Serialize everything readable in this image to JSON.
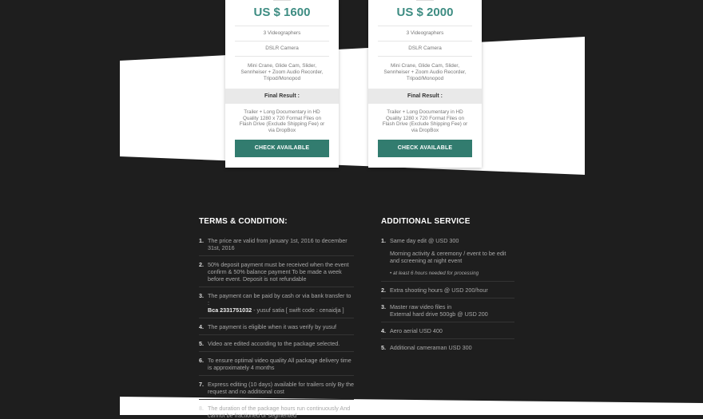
{
  "colors": {
    "accent": "#3d8c82",
    "button": "#327c6f",
    "background": "#1e1e1e"
  },
  "cards": [
    {
      "price": "US $ 1600",
      "features": [
        "3 Videographers",
        "DSLR Camera",
        "Mini Crane, Glide Cam, Slider, Sennheiser + Zoom Audio Recorder, Tripod/Monopod"
      ],
      "final_label": "Final Result :",
      "final_text": "Trailer + Long Documentary in HD Quality 1280 x 720 Format Files on Flash Drive (Exclude Shipping Fee) or via DropBox",
      "button": "CHECK AVAILABLE"
    },
    {
      "price": "US $ 2000",
      "features": [
        "3 Videographers",
        "DSLR Camera",
        "Mini Crane, Glide Cam, Slider, Sennheiser + Zoom Audio Recorder, Tripod/Monopod"
      ],
      "final_label": "Final Result :",
      "final_text": "Trailer + Long Documentary in HD Quality 1280 x 720 Format Files on Flash Drive (Exclude Shipping Fee) or via DropBox",
      "button": "CHECK AVAILABLE"
    }
  ],
  "terms": {
    "title": "TERMS & CONDITION:",
    "items": [
      {
        "num": "1.",
        "text": "The price are valid from january 1st, 2016 to december 31st, 2016"
      },
      {
        "num": "2.",
        "text": "50% deposit payment must be received when the event confirm & 50% balance payment To be made a week before event. Deposit is not refundable"
      },
      {
        "num": "3.",
        "text": "The payment can be paid by cash or via bank transfer to :",
        "bank": "Bca 2331751032",
        "bank_tail": " - yusuf satia [ swift code : cenaidja ]"
      },
      {
        "num": "4.",
        "text": "The payment is eligible when it was verify by yusuf"
      },
      {
        "num": "5.",
        "text": "Video are edited according to the package selected."
      },
      {
        "num": "6.",
        "text": "To ensure optimal video quality All package delivery time is approximately 4 months"
      },
      {
        "num": "7.",
        "text": "Express editing (10 days) available for trailers only By the request and no additional cost"
      },
      {
        "num": "8.",
        "text": "The duration of the package hours run continuously And cannot be fractioned or segmented"
      }
    ]
  },
  "additional": {
    "title": "ADDITIONAL SERVICE",
    "items": [
      {
        "num": "1.",
        "text": "Same day edit @ USD 300",
        "sub": "Morning activity & ceremony / event to be edit and screening at night event",
        "note": "• at least 6 hours needed for processing"
      },
      {
        "num": "2.",
        "text": "Extra shooting hours @ USD 200/hour"
      },
      {
        "num": "3.",
        "text": "Master raw video files in",
        "text2": "External hard drive 500gb @ USD 200"
      },
      {
        "num": "4.",
        "text": "Aero aerial USD 400"
      },
      {
        "num": "5.",
        "text": "Additional cameraman USD 300"
      }
    ]
  }
}
